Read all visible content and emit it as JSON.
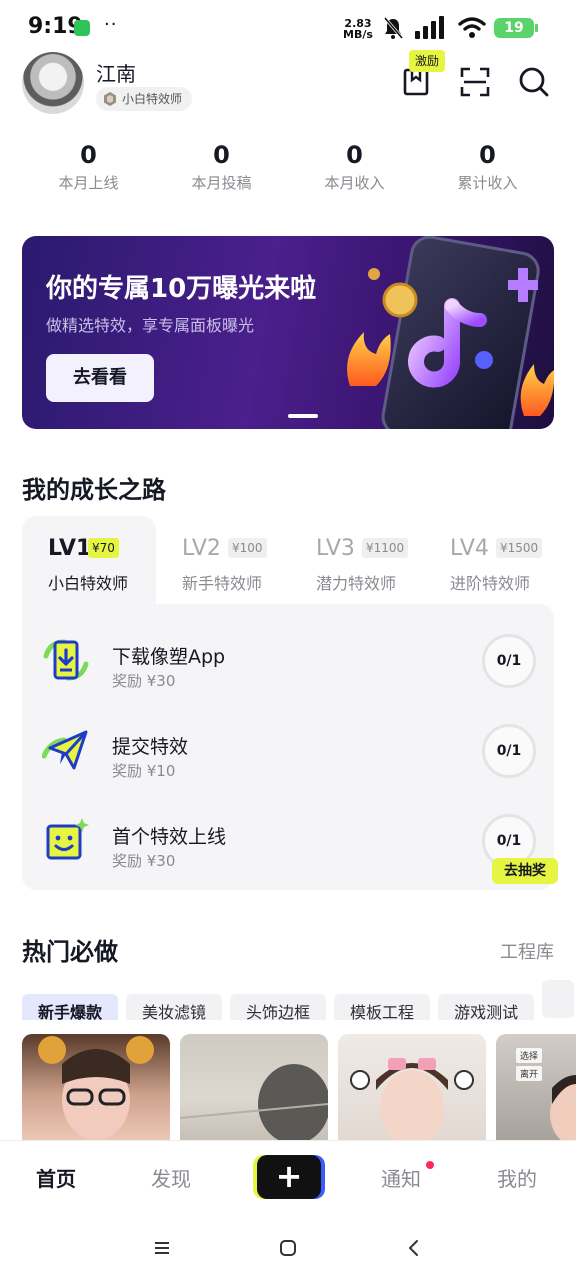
{
  "status_bar": {
    "time": "9:19",
    "dots": "··",
    "speed_value": "2.83",
    "speed_unit": "MB/s",
    "battery": "19"
  },
  "header": {
    "user_name": "江南",
    "level_badge": "小白特效师",
    "incentive_tag": "激励",
    "icons": [
      "bookmark-icon",
      "scan-icon",
      "search-icon"
    ]
  },
  "stats": [
    {
      "value": "0",
      "label": "本月上线"
    },
    {
      "value": "0",
      "label": "本月投稿"
    },
    {
      "value": "0",
      "label": "本月收入"
    },
    {
      "value": "0",
      "label": "累计收入"
    }
  ],
  "banner": {
    "title": "你的专属10万曝光来啦",
    "subtitle": "做精选特效，享专属面板曝光",
    "button": "去看看"
  },
  "growth": {
    "title": "我的成长之路",
    "levels": [
      {
        "name": "LV1",
        "reward": "¥70",
        "title": "小白特效师",
        "active": true
      },
      {
        "name": "LV2",
        "reward": "¥100",
        "title": "新手特效师",
        "active": false
      },
      {
        "name": "LV3",
        "reward": "¥1100",
        "title": "潜力特效师",
        "active": false
      },
      {
        "name": "LV4",
        "reward": "¥1500",
        "title": "进阶特效师",
        "active": false
      }
    ],
    "tasks": [
      {
        "name": "下载像塑App",
        "reward": "奖励 ¥30",
        "progress": "0/1",
        "icon": "download-phone-icon"
      },
      {
        "name": "提交特效",
        "reward": "奖励 ¥10",
        "progress": "0/1",
        "icon": "paper-plane-icon"
      },
      {
        "name": "首个特效上线",
        "reward": "奖励 ¥30",
        "progress": "0/1",
        "icon": "smiley-sparkle-icon"
      }
    ],
    "lottery_button": "去抽奖"
  },
  "hot": {
    "title": "热门必做",
    "link": "工程库",
    "chips": [
      "新手爆款",
      "美妆滤镜",
      "头饰边框",
      "模板工程",
      "游戏测试"
    ],
    "thumb_labels": [
      "选择",
      "离开"
    ]
  },
  "bottom_nav": {
    "items": [
      "首页",
      "发现",
      "通知",
      "我的"
    ],
    "plus": "+"
  },
  "colors": {
    "accent_yellow": "#e6f541",
    "notify_red": "#fe2c55",
    "chip_active": "#e5e8fd",
    "text_primary": "#161823",
    "text_secondary": "#8a8b91"
  }
}
